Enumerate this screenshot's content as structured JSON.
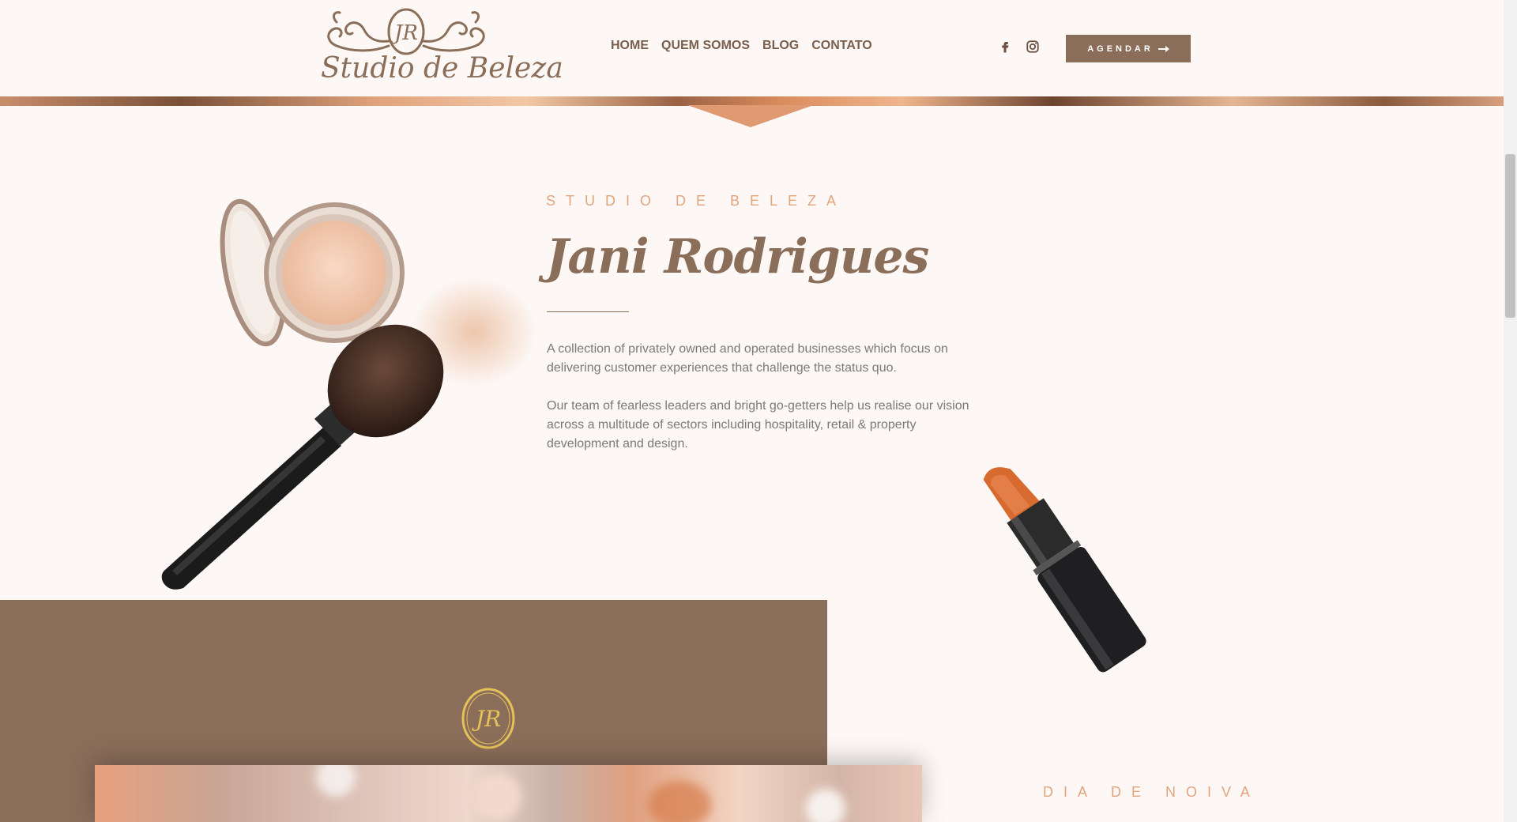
{
  "header": {
    "logo_text": "Studio de Beleza",
    "logo_monogram": "JR",
    "nav": [
      {
        "label": "HOME",
        "name": "nav-home"
      },
      {
        "label": "QUEM SOMOS",
        "name": "nav-quem-somos"
      },
      {
        "label": "BLOG",
        "name": "nav-blog"
      },
      {
        "label": "CONTATO",
        "name": "nav-contato"
      }
    ],
    "social_icons": [
      "facebook-icon",
      "instagram-icon"
    ],
    "cta_label": "AGENDAR",
    "cta_icon": "arrow-right-icon"
  },
  "about": {
    "eyebrow": "STUDIO DE BELEZA",
    "title": "Jani Rodrigues",
    "paragraph_1": "A collection of privately owned and operated businesses which focus on delivering customer experiences that challenge the status quo.",
    "paragraph_2": "Our team of fearless leaders and bright go-getters help us realise our vision across a multitude of sectors including hospitality, retail & property development and design.",
    "images": [
      "compact-powder-and-brush-image",
      "lipstick-image"
    ]
  },
  "services": {
    "monogram": "JR",
    "eyebrow": "DIA DE NOIVA"
  },
  "colors": {
    "background": "#fdf8f5",
    "brand_brown": "#8b6e5a",
    "accent_peach": "#e3a47d",
    "gold": "#e6c15a",
    "body_text": "#7a7a7a"
  }
}
